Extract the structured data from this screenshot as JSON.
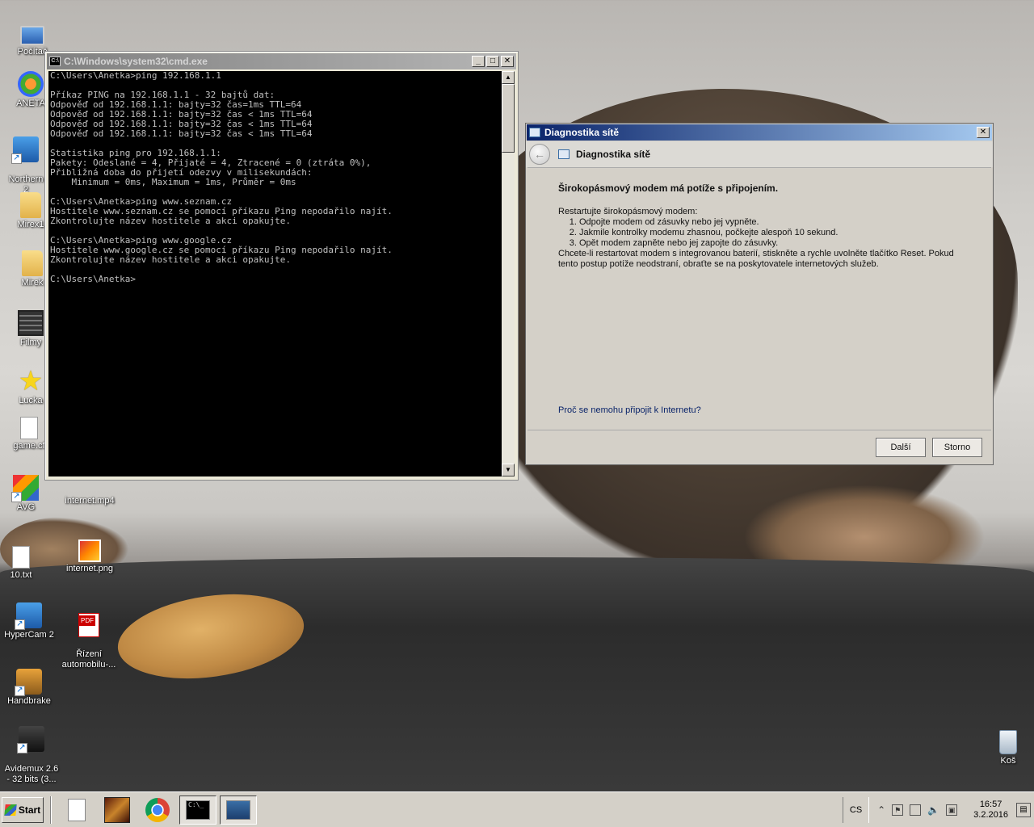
{
  "desktop": {
    "icons": [
      {
        "label": "Počítač"
      },
      {
        "label": "ANETA"
      },
      {
        "label": "Northern\n2"
      },
      {
        "label": "Mirex1"
      },
      {
        "label": "Mirek"
      },
      {
        "label": "Filmy"
      },
      {
        "label": "Lucka"
      },
      {
        "label": "game.cf"
      },
      {
        "label": "AVG"
      },
      {
        "label": "internet.mp4"
      },
      {
        "label": "10.txt"
      },
      {
        "label": "internet.png"
      },
      {
        "label": "HyperCam 2"
      },
      {
        "label": "Řízení\nautomobilu-..."
      },
      {
        "label": "Handbrake"
      },
      {
        "label": "Avidemux 2.6\n- 32 bits (3..."
      },
      {
        "label": "Koš"
      }
    ]
  },
  "cmd": {
    "title": "C:\\Windows\\system32\\cmd.exe",
    "output": "C:\\Users\\Anetka>ping 192.168.1.1\n\nPříkaz PING na 192.168.1.1 - 32 bajtů dat:\nOdpověď od 192.168.1.1: bajty=32 čas=1ms TTL=64\nOdpověď od 192.168.1.1: bajty=32 čas < 1ms TTL=64\nOdpověď od 192.168.1.1: bajty=32 čas < 1ms TTL=64\nOdpověď od 192.168.1.1: bajty=32 čas < 1ms TTL=64\n\nStatistika ping pro 192.168.1.1:\nPakety: Odeslané = 4, Přijaté = 4, Ztracené = 0 (ztráta 0%),\nPřibližná doba do přijetí odezvy v milisekundách:\n    Minimum = 0ms, Maximum = 1ms, Průměr = 0ms\n\nC:\\Users\\Anetka>ping www.seznam.cz\nHostitele www.seznam.cz se pomocí příkazu Ping nepodařilo najít.\nZkontrolujte název hostitele a akci opakujte.\n\nC:\\Users\\Anetka>ping www.google.cz\nHostitele www.google.cz se pomocí příkazu Ping nepodařilo najít.\nZkontrolujte název hostitele a akci opakujte.\n\nC:\\Users\\Anetka>",
    "minimize": "_",
    "maximize": "□",
    "close": "✕"
  },
  "diag": {
    "title": "Diagnostika sítě",
    "header_title": "Diagnostika sítě",
    "heading": "Širokopásmový modem má potíže s připojením.",
    "intro": "Restartujte širokopásmový modem:",
    "steps": [
      "Odpojte modem od zásuvky nebo jej vypněte.",
      "Jakmile kontrolky modemu zhasnou, počkejte alespoň 10 sekund.",
      "Opět modem zapněte nebo jej zapojte do zásuvky."
    ],
    "note": "Chcete-li restartovat modem s integrovanou baterií, stiskněte a rychle uvolněte tlačítko Reset. Pokud tento postup potíže neodstraní, obraťte se na poskytovatele internetových služeb.",
    "link": "Proč se nemohu připojit k Internetu?",
    "next_label": "Další",
    "cancel_label": "Storno",
    "close": "✕",
    "back": "←"
  },
  "taskbar": {
    "start_label": "Start",
    "lang": "CS",
    "time": "16:57",
    "date": "3.2.2016",
    "cmd_icon_text": "C:\\_"
  }
}
